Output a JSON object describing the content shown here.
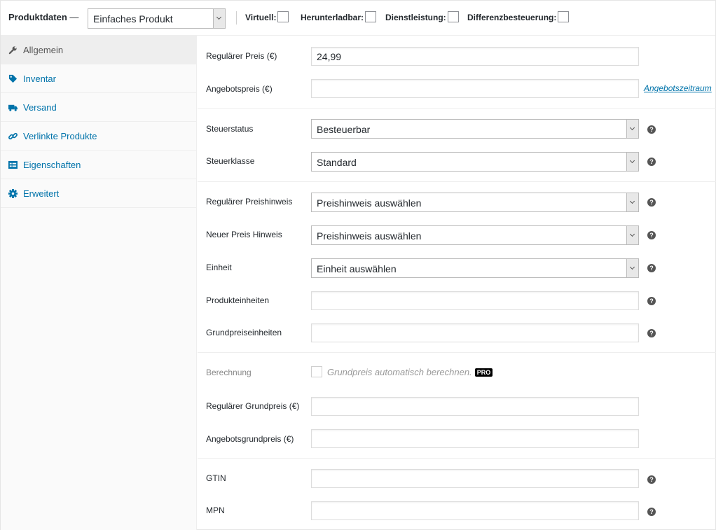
{
  "header": {
    "title": "Produktdaten",
    "dash": "—",
    "product_type": "Einfaches Produkt",
    "options": [
      {
        "label": "Virtuell:",
        "checked": false
      },
      {
        "label": "Herunterladbar:",
        "checked": false
      },
      {
        "label": "Dienstleistung:",
        "checked": false
      },
      {
        "label": "Differenzbesteuerung:",
        "checked": false
      }
    ]
  },
  "tabs": [
    {
      "label": "Allgemein",
      "icon": "wrench-icon",
      "active": true
    },
    {
      "label": "Inventar",
      "icon": "tag-icon",
      "active": false
    },
    {
      "label": "Versand",
      "icon": "truck-icon",
      "active": false
    },
    {
      "label": "Verlinkte Produkte",
      "icon": "link-icon",
      "active": false
    },
    {
      "label": "Eigenschaften",
      "icon": "list-icon",
      "active": false
    },
    {
      "label": "Erweitert",
      "icon": "gear-icon",
      "active": false
    }
  ],
  "fields": {
    "regular_price": {
      "label": "Regulärer Preis (€)",
      "value": "24,99"
    },
    "sale_price": {
      "label": "Angebotspreis (€)",
      "value": "",
      "link": "Angebotszeitraum"
    },
    "tax_status": {
      "label": "Steuerstatus",
      "value": "Besteuerbar"
    },
    "tax_class": {
      "label": "Steuerklasse",
      "value": "Standard"
    },
    "regular_price_notice": {
      "label": "Regulärer Preishinweis",
      "value": "Preishinweis auswählen"
    },
    "new_price_notice": {
      "label": "Neuer Preis Hinweis",
      "value": "Preishinweis auswählen"
    },
    "unit": {
      "label": "Einheit",
      "value": "Einheit auswählen"
    },
    "product_units": {
      "label": "Produkteinheiten",
      "value": ""
    },
    "base_price_units": {
      "label": "Grundpreiseinheiten",
      "value": ""
    },
    "calculation": {
      "label": "Berechnung",
      "text": "Grundpreis automatisch berechnen.",
      "badge": "PRO"
    },
    "regular_base_price": {
      "label": "Regulärer Grundpreis (€)",
      "value": ""
    },
    "sale_base_price": {
      "label": "Angebotsgrundpreis (€)",
      "value": ""
    },
    "gtin": {
      "label": "GTIN",
      "value": ""
    },
    "mpn": {
      "label": "MPN",
      "value": ""
    }
  },
  "help_symbol": "?",
  "colors": {
    "link": "#0073aa",
    "active_tab_bg": "#eeeeee",
    "sidebar_bg": "#fafafa"
  }
}
